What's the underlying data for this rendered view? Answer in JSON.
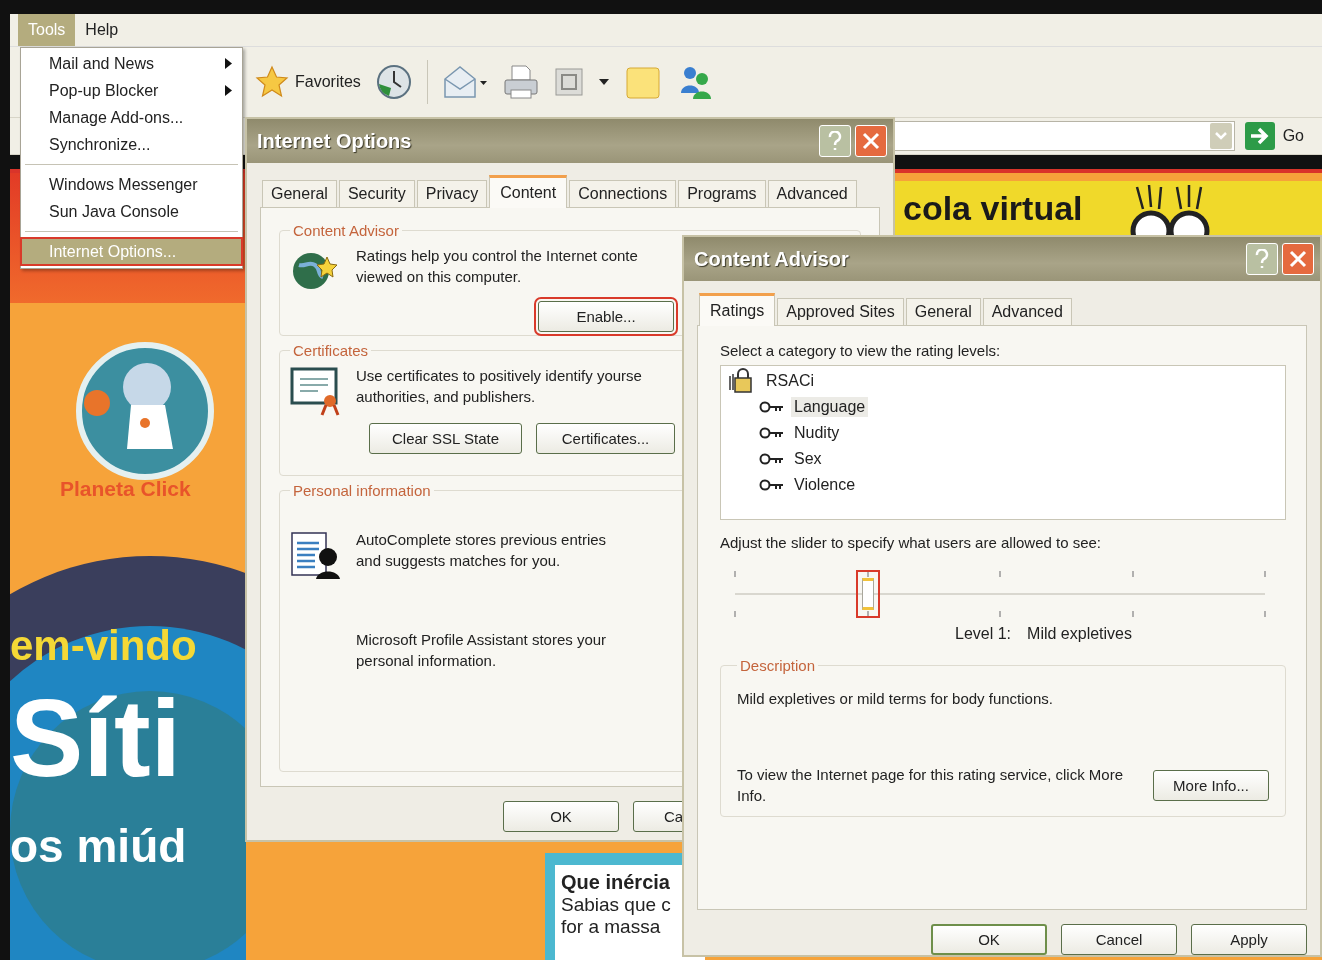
{
  "menu_bar": [
    {
      "label": "Tools",
      "selected": true
    },
    {
      "label": "Help",
      "selected": false
    }
  ],
  "tools_menu": {
    "groups": [
      {
        "items": [
          {
            "label": "Mail and News",
            "submenu": true,
            "selected": false,
            "marked": false
          },
          {
            "label": "Pop-up Blocker",
            "submenu": true,
            "selected": false,
            "marked": false
          },
          {
            "label": "Manage Add-ons...",
            "submenu": false,
            "selected": false,
            "marked": false
          },
          {
            "label": "Synchronize...",
            "submenu": false,
            "selected": false,
            "marked": false
          }
        ]
      },
      {
        "items": [
          {
            "label": "Windows Messenger",
            "submenu": false,
            "selected": false,
            "marked": false
          },
          {
            "label": "Sun Java Console",
            "submenu": false,
            "selected": false,
            "marked": false
          }
        ]
      },
      {
        "items": [
          {
            "label": "Internet Options...",
            "submenu": false,
            "selected": true,
            "marked": true
          }
        ]
      }
    ]
  },
  "toolbar": {
    "favorites_label": "Favorites"
  },
  "address_bar": {
    "go_label": "Go"
  },
  "web_page": {
    "banner_text": "cola virtual",
    "logo_caption": "Planeta Click",
    "headline_lines": [
      "em-vindo",
      "Síti",
      "os miúd"
    ],
    "card": {
      "title": "Que inércia",
      "lines": [
        "Sabias que c",
        "for a massa"
      ]
    }
  },
  "internet_options": {
    "title": "Internet Options",
    "tabs": [
      {
        "label": "General",
        "selected": false
      },
      {
        "label": "Security",
        "selected": false
      },
      {
        "label": "Privacy",
        "selected": false
      },
      {
        "label": "Content",
        "selected": true
      },
      {
        "label": "Connections",
        "selected": false
      },
      {
        "label": "Programs",
        "selected": false
      },
      {
        "label": "Advanced",
        "selected": false
      }
    ],
    "groups": [
      {
        "title": "Content Advisor",
        "entries": [
          {
            "lines": [
              "Ratings help you control the Internet conte",
              "viewed on this computer."
            ]
          }
        ],
        "buttons": [
          {
            "label": "Enable...",
            "marked": true
          }
        ]
      },
      {
        "title": "Certificates",
        "entries": [
          {
            "lines": [
              "Use certificates to positively identify yourse",
              "authorities, and publishers."
            ]
          }
        ],
        "buttons": [
          {
            "label": "Clear SSL State",
            "marked": false
          },
          {
            "label": "Certificates...",
            "marked": false
          }
        ]
      },
      {
        "title": "Personal information",
        "entries": [
          {
            "lines": [
              "AutoComplete stores previous entries",
              "and suggests matches for you."
            ]
          },
          {
            "lines": [
              "Microsoft Profile Assistant stores your",
              "personal information."
            ]
          }
        ]
      }
    ],
    "buttons": [
      "OK",
      "Ca"
    ]
  },
  "content_advisor": {
    "title": "Content Advisor",
    "tabs": [
      {
        "label": "Ratings",
        "selected": true
      },
      {
        "label": "Approved Sites",
        "selected": false
      },
      {
        "label": "General",
        "selected": false
      },
      {
        "label": "Advanced",
        "selected": false
      }
    ],
    "category_prompt": "Select a category to view the rating levels:",
    "tree": {
      "label": "RSACi",
      "children": [
        {
          "label": "Language",
          "selected": true
        },
        {
          "label": "Nudity",
          "selected": false
        },
        {
          "label": "Sex",
          "selected": false
        },
        {
          "label": "Violence",
          "selected": false
        }
      ]
    },
    "slider_prompt": "Adjust the slider to specify what users are allowed to see:",
    "slider": {
      "level": 0.25,
      "marked": true
    },
    "level_label": "Level 1:",
    "level_name": "Mild expletives",
    "description": {
      "title": "Description",
      "text": "Mild expletives or mild terms for body functions.",
      "info": "To view the Internet page for this rating service, click More Info.",
      "button": "More Info..."
    },
    "buttons": [
      "OK",
      "Cancel",
      "Apply"
    ]
  }
}
